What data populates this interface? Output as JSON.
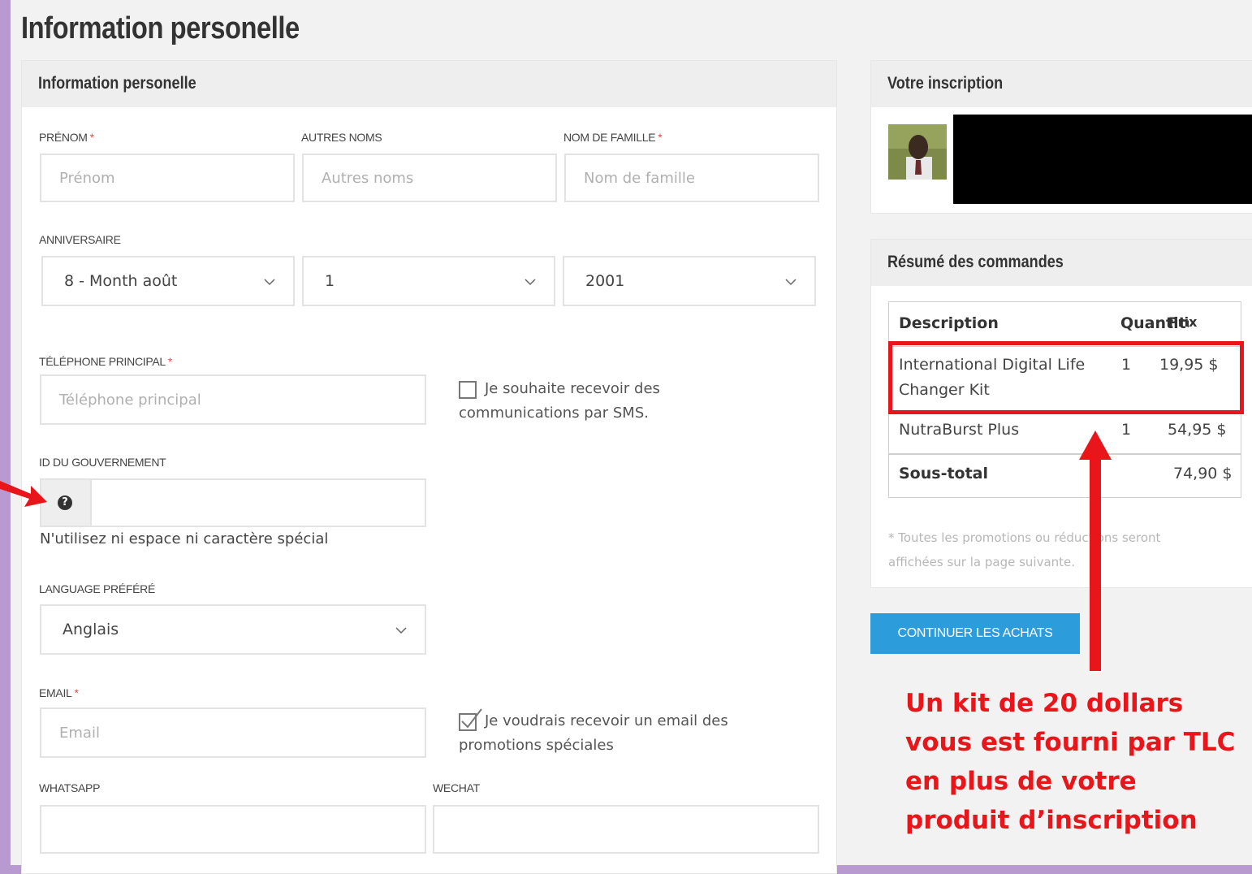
{
  "page": {
    "title": "Information personelle"
  },
  "form": {
    "header": "Information personelle",
    "first_name": {
      "label": "PRÉNOM",
      "placeholder": "Prénom"
    },
    "other_names": {
      "label": "AUTRES NOMS",
      "placeholder": "Autres noms"
    },
    "last_name": {
      "label": "NOM DE FAMILLE",
      "placeholder": "Nom de famille"
    },
    "birthday": {
      "label": "ANNIVERSAIRE",
      "month": "8 - Month août",
      "day": "1",
      "year": "2001"
    },
    "phone": {
      "label": "TÉLÉPHONE PRINCIPAL",
      "placeholder": "Téléphone principal"
    },
    "sms_opt": {
      "line1": "Je souhaite recevoir des",
      "line2": "communications par SMS.",
      "checked": false
    },
    "gov_id": {
      "label": "ID DU GOUVERNEMENT",
      "help_icon": "?",
      "hint": "N'utilisez ni espace ni caractère spécial"
    },
    "language": {
      "label": "LANGUAGE PRÉFÉRÉ",
      "value": "Anglais"
    },
    "email": {
      "label": "EMAIL",
      "placeholder": "Email"
    },
    "email_opt": {
      "line1": "Je voudrais recevoir un email des",
      "line2": "promotions spéciales",
      "checked": true
    },
    "whatsapp": {
      "label": "WHATSAPP"
    },
    "wechat": {
      "label": "WECHAT"
    },
    "required_mark": "*"
  },
  "registration": {
    "header": "Votre inscription"
  },
  "summary": {
    "header": "Résumé des commandes",
    "columns": {
      "description": "Description",
      "quantity": "Quantité",
      "price": "Prix"
    },
    "items": [
      {
        "line1": "International Digital Life",
        "line2": "Changer Kit",
        "qty": "1",
        "price": "19,95 $"
      },
      {
        "line1": "NutraBurst Plus",
        "line2": "",
        "qty": "1",
        "price": "54,95 $"
      }
    ],
    "subtotal_label": "Sous-total",
    "subtotal_value": "74,90 $",
    "note_line1": "* Toutes les promotions ou réductions seront",
    "note_line2": "affichées sur la page suivante."
  },
  "button": {
    "continue": "CONTINUER LES ACHATS"
  },
  "annotation": {
    "lines": [
      "Un kit de 20 dollars",
      "vous est fourni par TLC",
      "en plus de votre",
      "produit d’inscription"
    ]
  },
  "colors": {
    "highlight": "#e8161a",
    "button": "#2d9cdb",
    "frame": "#b89ad0"
  }
}
